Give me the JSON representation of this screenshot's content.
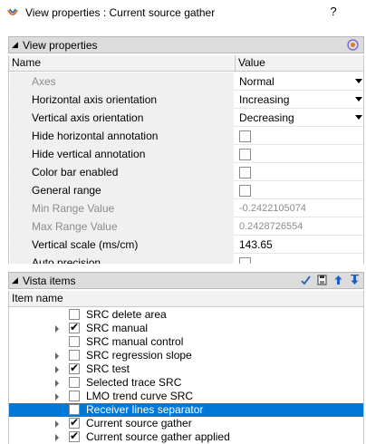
{
  "window": {
    "title": "View properties : Current source gather",
    "help_label": "?"
  },
  "view_properties": {
    "header": "View properties",
    "columns": {
      "name": "Name",
      "value": "Value"
    },
    "rows": [
      {
        "name": "Axes",
        "value": "Normal",
        "kind": "dropdown",
        "disabled": true
      },
      {
        "name": "Horizontal axis orientation",
        "value": "Increasing",
        "kind": "dropdown",
        "disabled": false
      },
      {
        "name": "Vertical axis orientation",
        "value": "Decreasing",
        "kind": "dropdown",
        "disabled": false
      },
      {
        "name": "Hide horizontal annotation",
        "value": "",
        "kind": "checkbox",
        "checked": false,
        "disabled": false
      },
      {
        "name": "Hide vertical annotation",
        "value": "",
        "kind": "checkbox",
        "checked": false,
        "disabled": false
      },
      {
        "name": "Color bar enabled",
        "value": "",
        "kind": "checkbox",
        "checked": false,
        "disabled": false
      },
      {
        "name": "General range",
        "value": "",
        "kind": "checkbox",
        "checked": false,
        "disabled": false
      },
      {
        "name": "Min Range Value",
        "value": "-0.2422105074",
        "kind": "text",
        "disabled": true
      },
      {
        "name": "Max Range Value",
        "value": "0.2428726554",
        "kind": "text",
        "disabled": true
      },
      {
        "name": "Vertical scale (ms/cm)",
        "value": "143.65",
        "kind": "text",
        "disabled": false
      },
      {
        "name": "Auto precision",
        "value": "",
        "kind": "checkbox",
        "checked": false,
        "disabled": false
      }
    ]
  },
  "vista_items": {
    "header": "Vista items",
    "column": "Item name",
    "tools": [
      "checkmark-icon",
      "save-icon",
      "move-up-icon",
      "move-down-icon"
    ],
    "items": [
      {
        "label": "SRC delete area",
        "checked": false,
        "expandable": false,
        "selected": false
      },
      {
        "label": "SRC manual",
        "checked": true,
        "expandable": true,
        "selected": false
      },
      {
        "label": "SRC manual control",
        "checked": false,
        "expandable": false,
        "selected": false
      },
      {
        "label": "SRC regression slope",
        "checked": false,
        "expandable": true,
        "selected": false
      },
      {
        "label": "SRC test",
        "checked": true,
        "expandable": true,
        "selected": false
      },
      {
        "label": "Selected trace SRC",
        "checked": false,
        "expandable": true,
        "selected": false
      },
      {
        "label": "LMO trend curve SRC",
        "checked": false,
        "expandable": true,
        "selected": false
      },
      {
        "label": "Receiver lines separator",
        "checked": false,
        "expandable": false,
        "selected": true
      },
      {
        "label": "Current source gather",
        "checked": true,
        "expandable": true,
        "selected": false
      },
      {
        "label": "Current source gather applied",
        "checked": true,
        "expandable": true,
        "selected": false
      }
    ]
  }
}
